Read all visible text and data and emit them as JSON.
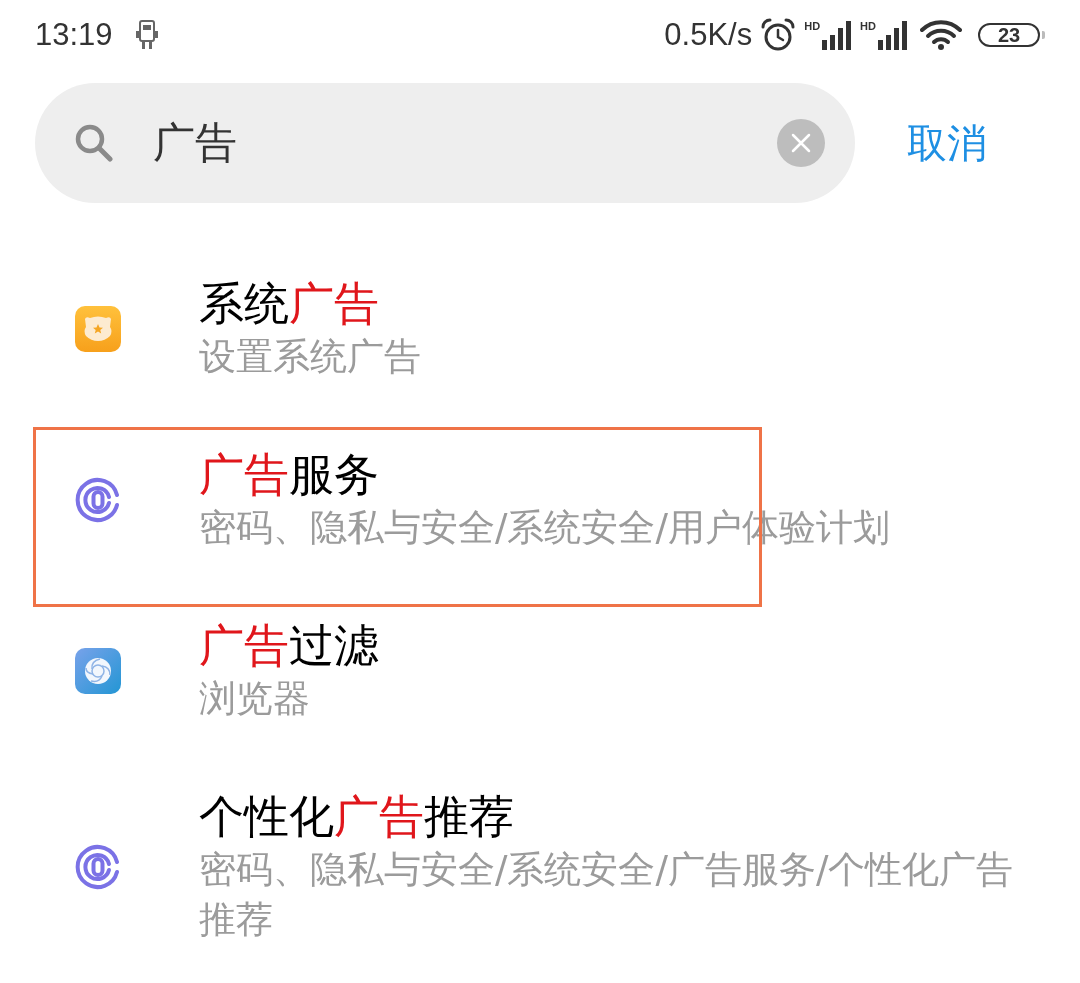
{
  "status_bar": {
    "time": "13:19",
    "speed": "0.5K/s",
    "signals": [
      {
        "label": "HD"
      },
      {
        "label": "HD"
      }
    ],
    "battery": "23"
  },
  "search": {
    "value": "广告",
    "cancel": "取消"
  },
  "results": [
    {
      "kind": "system",
      "title": [
        {
          "text": "系统",
          "match": false
        },
        {
          "text": "广告",
          "match": true
        }
      ],
      "path": "设置系统广告",
      "annotated": false
    },
    {
      "kind": "privacy",
      "title": [
        {
          "text": "广告",
          "match": true
        },
        {
          "text": "服务",
          "match": false
        }
      ],
      "path": "密码、隐私与安全/系统安全/用户体验计划",
      "annotated": true
    },
    {
      "kind": "browser",
      "title": [
        {
          "text": "广告",
          "match": true
        },
        {
          "text": "过滤",
          "match": false
        }
      ],
      "path": "浏览器",
      "annotated": false
    },
    {
      "kind": "privacy",
      "title": [
        {
          "text": "个性化",
          "match": false
        },
        {
          "text": "广告",
          "match": true
        },
        {
          "text": "推荐",
          "match": false
        }
      ],
      "path": "密码、隐私与安全/系统安全/广告服务/个性化广告推荐",
      "annotated": false
    }
  ]
}
